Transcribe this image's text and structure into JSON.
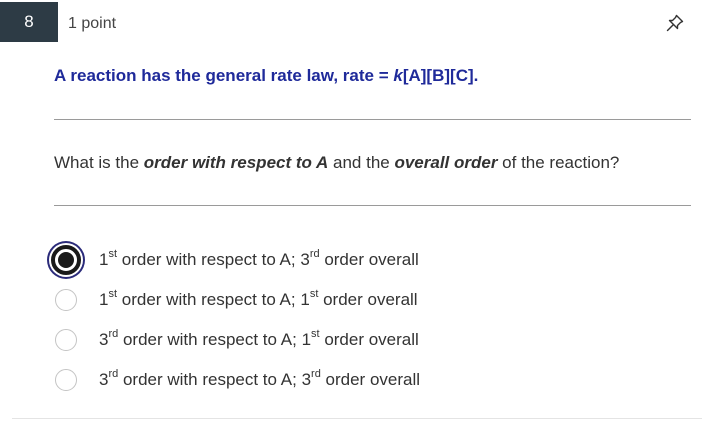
{
  "question": {
    "number": "8",
    "points": "1 point",
    "pin_icon": "pin-icon",
    "prompt_pre": "A reaction has the general rate law, rate = ",
    "prompt_k": "k",
    "prompt_post": "[A][B][C].",
    "text_pre": "What is the ",
    "text_bold1": "order with respect to A",
    "text_mid": " and the ",
    "text_bold2": "overall order",
    "text_post": " of the reaction?"
  },
  "options": [
    {
      "selected": true,
      "a_num": "1",
      "a_sup": "st",
      "mid": " order with respect to A; ",
      "b_num": "3",
      "b_sup": "rd",
      "end": " order overall"
    },
    {
      "selected": false,
      "a_num": "1",
      "a_sup": "st",
      "mid": " order with respect to A; ",
      "b_num": "1",
      "b_sup": "st",
      "end": " order overall"
    },
    {
      "selected": false,
      "a_num": "3",
      "a_sup": "rd",
      "mid": " order with respect to A; ",
      "b_num": "1",
      "b_sup": "st",
      "end": " order overall"
    },
    {
      "selected": false,
      "a_num": "3",
      "a_sup": "rd",
      "mid": " order with respect to A; ",
      "b_num": "3",
      "b_sup": "rd",
      "end": " order overall"
    }
  ],
  "colors": {
    "number_bg": "#2d3b45",
    "prompt_text": "#1f2a9a",
    "selected_ring": "#2b2b7a"
  }
}
